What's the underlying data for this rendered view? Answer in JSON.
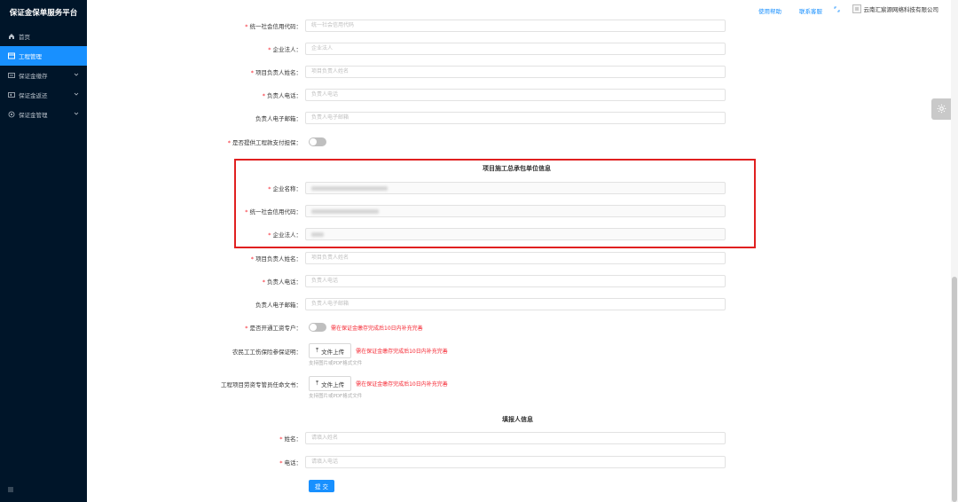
{
  "app": {
    "title": "保证金保单服务平台"
  },
  "sidebar": {
    "items": [
      {
        "label": "首页",
        "icon": "home-icon",
        "active": false,
        "expandable": false
      },
      {
        "label": "工程管理",
        "icon": "project-icon",
        "active": true,
        "expandable": false
      },
      {
        "label": "保证金缴存",
        "icon": "deposit-icon",
        "active": false,
        "expandable": true
      },
      {
        "label": "保证金返还",
        "icon": "return-icon",
        "active": false,
        "expandable": true
      },
      {
        "label": "保证金管理",
        "icon": "manage-icon",
        "active": false,
        "expandable": true
      }
    ],
    "collapse_icon": "menu-fold-icon"
  },
  "topbar": {
    "help": "使用帮助",
    "service": "联系客服",
    "company": "云南汇宸源网络科技有限公司"
  },
  "form_top": {
    "credit_code": {
      "label": "统一社会信用代码",
      "required": true,
      "placeholder": "统一社会信用代码"
    },
    "legal_person": {
      "label": "企业法人",
      "required": true,
      "placeholder": "企业法人"
    },
    "manager_name": {
      "label": "项目负责人姓名",
      "required": true,
      "placeholder": "项目负责人姓名"
    },
    "manager_phone": {
      "label": "负责人电话",
      "required": true,
      "placeholder": "负责人电话"
    },
    "manager_email": {
      "label": "负责人电子邮箱",
      "required": false,
      "placeholder": "负责人电子邮箱"
    },
    "provide_account": {
      "label": "是否提供工程款支付担保",
      "required": true,
      "on": false
    }
  },
  "contractor_section": {
    "title": "项目施工总承包单位信息",
    "company_name": {
      "label": "企业名称",
      "required": true
    },
    "credit_code": {
      "label": "统一社会信用代码",
      "required": true
    },
    "legal_person": {
      "label": "企业法人",
      "required": true
    }
  },
  "form_bottom": {
    "manager_name": {
      "label": "项目负责人姓名",
      "required": true,
      "placeholder": "项目负责人姓名"
    },
    "manager_phone": {
      "label": "负责人电话",
      "required": true,
      "placeholder": "负责人电话"
    },
    "manager_email": {
      "label": "负责人电子邮箱",
      "required": false,
      "placeholder": "负责人电子邮箱"
    },
    "wage_account": {
      "label": "是否开通工资专户",
      "required": true,
      "on": false,
      "hint": "需在保证金缴存完成后10日内补充完善"
    },
    "insurance_cert": {
      "label": "农民工工伤保险参保证明",
      "button": "文件上传",
      "hint": "需在保证金缴存完成后10日内补充完善",
      "sub_hint": "支持图片或PDF格式文件"
    },
    "labor_appointment": {
      "label": "工程项目劳资专管员任命文书",
      "button": "文件上传",
      "hint": "需在保证金缴存完成后10日内补充完善",
      "sub_hint": "支持图片或PDF格式文件"
    }
  },
  "filler_section": {
    "title": "填报人信息",
    "name": {
      "label": "姓名",
      "required": true,
      "placeholder": "请填入姓名"
    },
    "phone": {
      "label": "电话",
      "required": true,
      "placeholder": "请填入电话"
    }
  },
  "submit": {
    "label": "提 交"
  },
  "colors": {
    "sidebar_bg": "#001529",
    "accent": "#1890ff",
    "highlight_box": "#e02020",
    "required": "#f5222d"
  }
}
